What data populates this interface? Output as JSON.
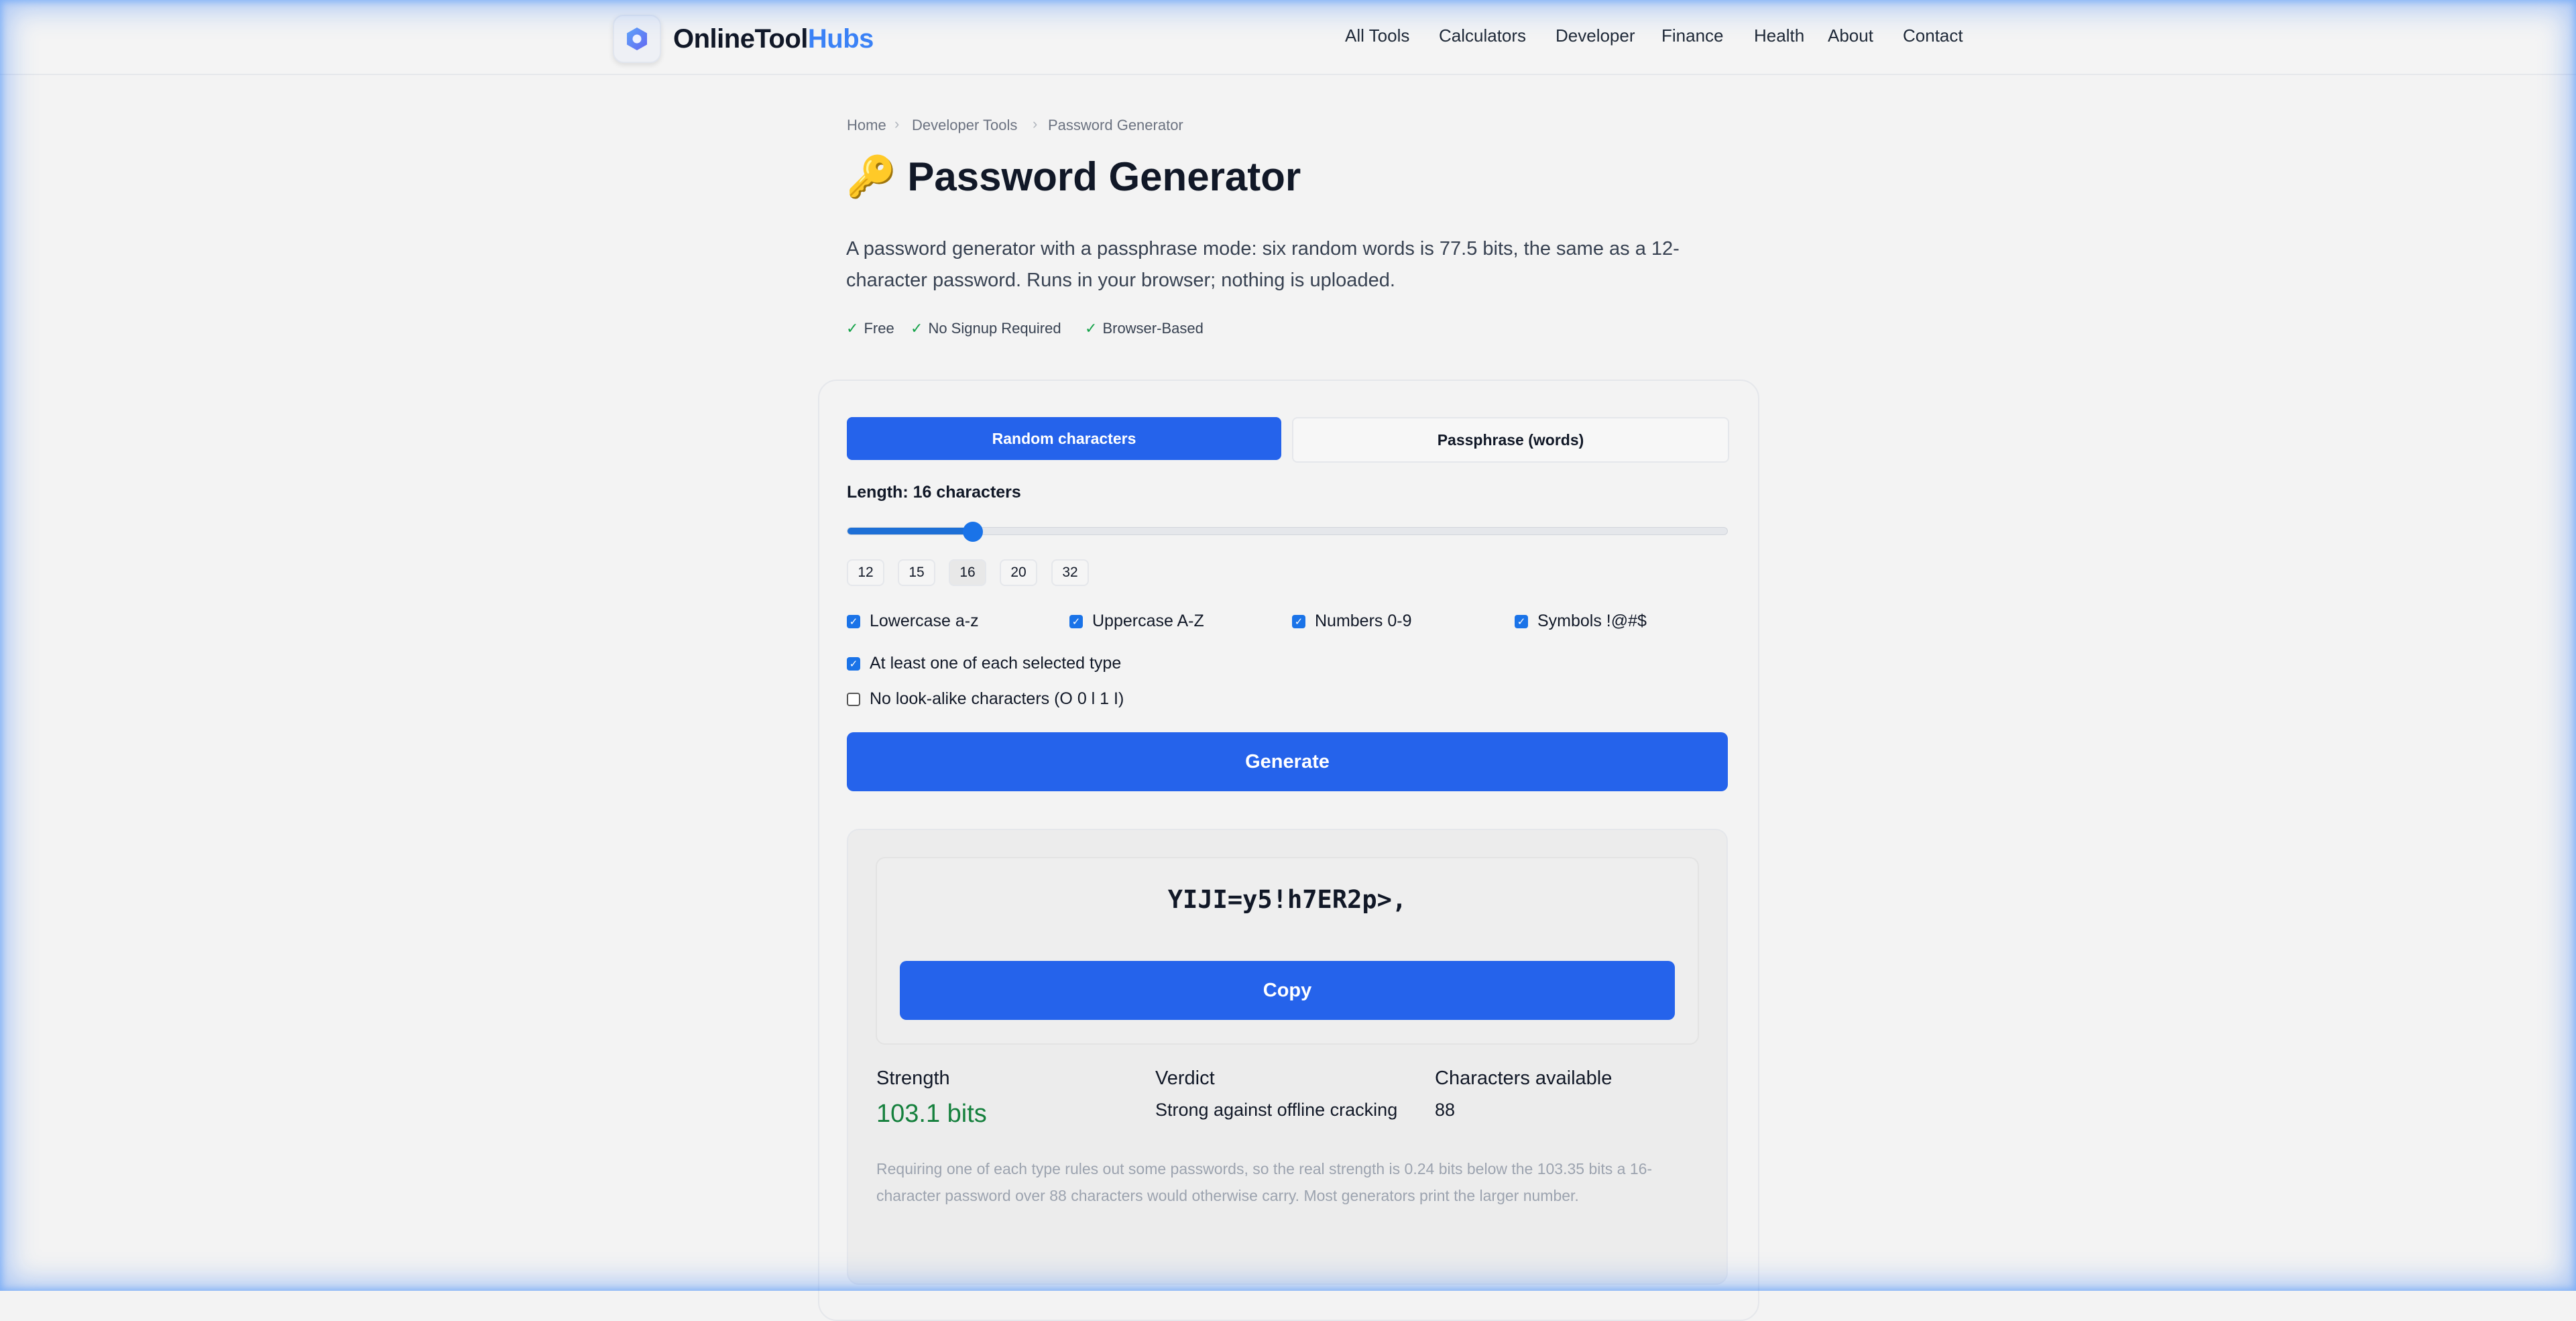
{
  "header": {
    "brand_part1": "OnlineTool",
    "brand_part2": "Hubs",
    "nav": [
      "All Tools",
      "Calculators",
      "Developer",
      "Finance",
      "Health",
      "About",
      "Contact"
    ]
  },
  "breadcrumb": [
    "Home",
    "Developer Tools",
    "Password Generator"
  ],
  "page": {
    "title_icon": "🔑",
    "title": "Password Generator",
    "description": "A password generator with a passphrase mode: six random words is 77.5 bits, the same as a 12-character password. Runs in your browser; nothing is uploaded.",
    "features": [
      "Free",
      "No Signup Required",
      "Browser-Based"
    ]
  },
  "tool": {
    "tabs": [
      "Random characters",
      "Passphrase (words)"
    ],
    "length_label": "Length: 16 characters",
    "length_value": 16,
    "length_min": 8,
    "length_max": 64,
    "presets": [
      "12",
      "15",
      "16",
      "20",
      "32"
    ],
    "options": [
      {
        "label": "Lowercase a-z",
        "checked": true
      },
      {
        "label": "Uppercase A-Z",
        "checked": true
      },
      {
        "label": "Numbers 0-9",
        "checked": true
      },
      {
        "label": "Symbols !@#$",
        "checked": true
      },
      {
        "label": "At least one of each selected type",
        "checked": true
      },
      {
        "label": "No look-alike characters (O 0 l 1 I)",
        "checked": false
      }
    ],
    "generate_label": "Generate",
    "password": "YIJI=y5!h7ER2p>,",
    "copy_label": "Copy",
    "strength_label": "Strength",
    "strength_value": "103.1 bits",
    "verdict_label": "Verdict",
    "verdict_value": "Strong against offline cracking",
    "chars_label": "Characters available",
    "chars_value": "88",
    "note": "Requiring one of each type rules out some passwords, so the real strength is 0.24 bits below the 103.35 bits a 16-character password over 88 characters would otherwise carry. Most generators print the larger number."
  },
  "colors": {
    "accent": "#2563eb",
    "strength_green": "#15803d",
    "check_green": "#16a34a",
    "brand_blue": "#3b82f6"
  }
}
